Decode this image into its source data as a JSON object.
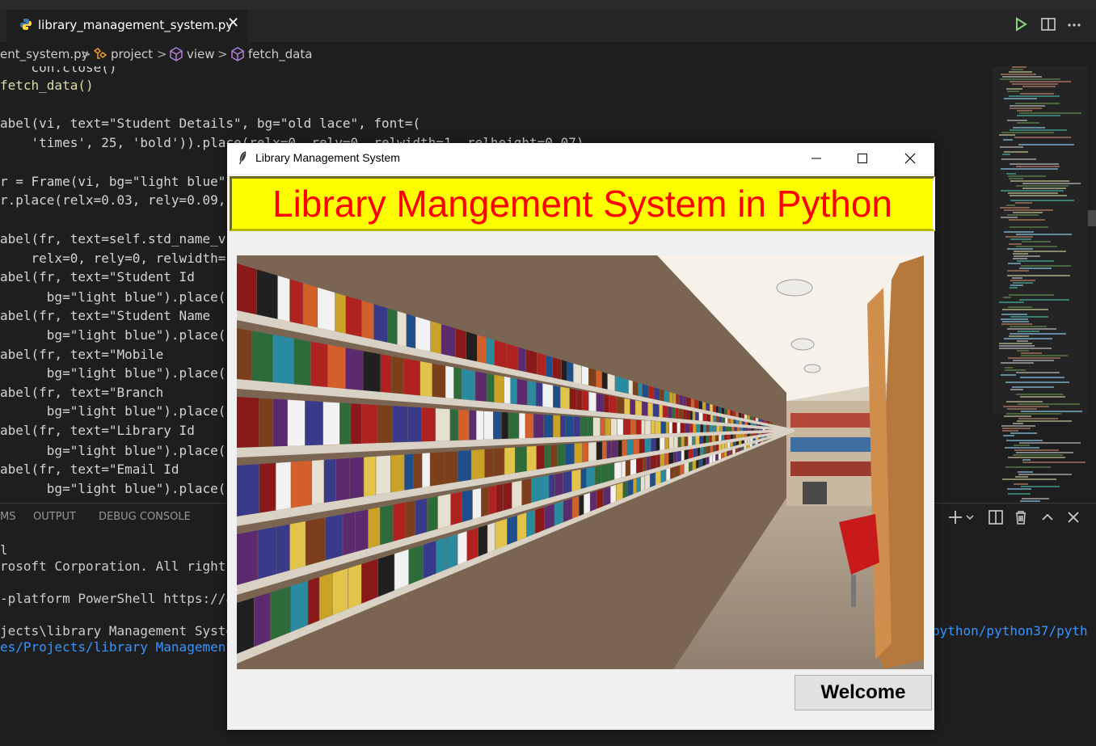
{
  "editor": {
    "tab": {
      "filename": "library_management_system.py",
      "close_glyph": "✕"
    },
    "breadcrumb": [
      {
        "label": "ent_system.py",
        "icon": "python-file-icon"
      },
      {
        "label": "project",
        "icon": "class-icon"
      },
      {
        "label": "view",
        "icon": "method-icon"
      },
      {
        "label": "fetch_data",
        "icon": "method-icon"
      }
    ],
    "breadcrumb_sep": ">",
    "actions": [
      "run-icon",
      "split-editor-icon",
      "more-icon"
    ],
    "code_lines": [
      "    con.close()",
      "fetch_data()",
      "",
      "abel(vi, text=\"Student Details\", bg=\"old lace\", font=(",
      "    'times', 25, 'bold')).place(relx=0, rely=0, relwidth=1, relheight=0.07)",
      "",
      "r = Frame(vi, bg=\"light blue\"",
      "r.place(relx=0.03, rely=0.09,",
      "",
      "abel(fr, text=self.std_name_v",
      "    relx=0, rely=0, relwidth=1",
      "abel(fr, text=\"Student Id",
      "      bg=\"light blue\").place(r",
      "abel(fr, text=\"Student Name",
      "      bg=\"light blue\").place(r",
      "abel(fr, text=\"Mobile",
      "      bg=\"light blue\").place(r",
      "abel(fr, text=\"Branch",
      "      bg=\"light blue\").place(r",
      "abel(fr, text=\"Library Id",
      "      bg=\"light blue\").place(r",
      "abel(fr, text=\"Email Id",
      "      bg=\"light blue\").place(r"
    ]
  },
  "panel": {
    "tabs": [
      "MS",
      "OUTPUT",
      "DEBUG CONSOLE"
    ],
    "actions": [
      "add-terminal-icon",
      "split-terminal-icon",
      "trash-icon",
      "maximize-panel-icon",
      "close-panel-icon"
    ],
    "terminal_lines": [
      "l",
      "rosoft Corporation. All rights",
      "-platform PowerShell https://ak",
      "jects\\library Management System",
      "es/Projects/library Management"
    ],
    "terminal_right_link": "python/python37/pyth"
  },
  "tk_window": {
    "title": "Library Management System",
    "header": "Library Mangement System in Python",
    "button": "Welcome",
    "colors": {
      "header_bg": "#ffff00",
      "header_fg": "#ff0000",
      "bg": "#f0f0f0"
    }
  },
  "photo": {
    "description_icon": "library-bookshelves-photo"
  }
}
